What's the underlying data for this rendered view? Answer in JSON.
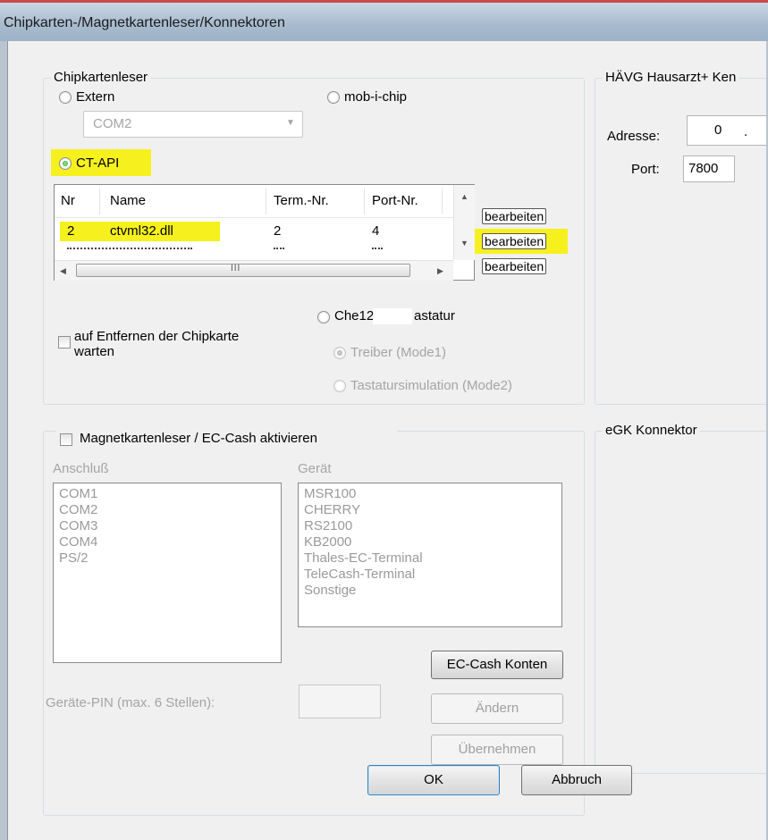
{
  "window": {
    "title": "Chipkarten-/Magnetkartenleser/Konnektoren"
  },
  "chipcard": {
    "legend": "Chipkartenleser",
    "extern_label": "Extern",
    "mobichip_label": "mob-i-chip",
    "com_value": "COM2",
    "ctapi_label": "CT-API",
    "table": {
      "headers": [
        "Nr",
        "Name",
        "Term.-Nr.",
        "Port-Nr."
      ],
      "rows": [
        {
          "nr": "2",
          "name": "ctvml32.dll",
          "term": "2",
          "port": "4"
        }
      ],
      "hscroll_grip": "III"
    },
    "edit_label": "bearbeiten",
    "wait_label_line1": "auf Entfernen der Chipkarte",
    "wait_label_line2": "warten",
    "keyboard_label_a": "Che12",
    "keyboard_label_b": "astatur",
    "mode1_label": "Treiber (Mode1)",
    "mode2_label": "Tastatursimulation (Mode2)"
  },
  "havg": {
    "legend": "HÄVG Hausarzt+ Ken",
    "address_label": "Adresse:",
    "address_value": "0",
    "address_dot": ".",
    "port_label": "Port:",
    "port_value": "7800"
  },
  "magnet": {
    "legend_label": "Magnetkartenleser / EC-Cash aktivieren",
    "port_header": "Anschluß",
    "device_header": "Gerät",
    "ports": [
      "COM1",
      "COM2",
      "COM3",
      "COM4",
      "PS/2"
    ],
    "devices": [
      "MSR100",
      "CHERRY",
      "RS2100",
      "KB2000",
      "Thales-EC-Terminal",
      "TeleCash-Terminal",
      "Sonstige"
    ],
    "ec_accounts_button": "EC-Cash Konten",
    "pin_label": "Geräte-PIN (max. 6 Stellen):",
    "change_button": "Ändern",
    "apply_button": "Übernehmen"
  },
  "egk": {
    "legend": "eGK Konnektor"
  },
  "footer": {
    "ok_button": "OK",
    "cancel_button": "Abbruch"
  },
  "colors": {
    "highlight": "#f6f11e",
    "title_accent": "#c84a4a"
  }
}
